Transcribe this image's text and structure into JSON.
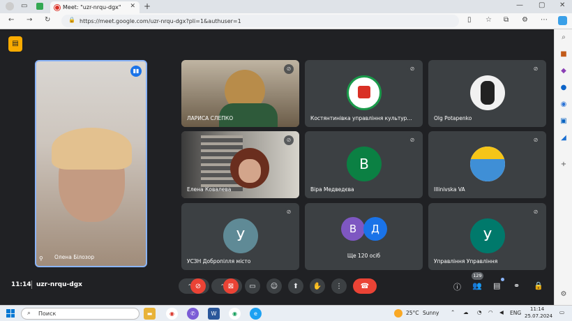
{
  "browser": {
    "tab_title": "Meet: \"uzr-nrqu-dgx\"",
    "url": "https://meet.google.com/uzr-nrqu-dgx?pli=1&authuser=1"
  },
  "meet": {
    "main_participant": {
      "name": "Олена Білозор"
    },
    "tiles": [
      {
        "name": "ЛАРИСА СЛЕПКО",
        "kind": "video"
      },
      {
        "name": "Костянтинівка управління культур...",
        "kind": "logo"
      },
      {
        "name": "Olg Potapenko",
        "kind": "photo"
      },
      {
        "name": "Елена Ковалева",
        "kind": "video"
      },
      {
        "name": "Віра Медведєва",
        "kind": "avatar",
        "letter": "В",
        "color": "#0b8043"
      },
      {
        "name": "Illinivska VA",
        "kind": "logo"
      },
      {
        "name": "УСЗН Добропілля місто",
        "kind": "avatar",
        "letter": "У",
        "color": "#5f8a96"
      },
      {
        "name": "Ще 120 осіб",
        "kind": "more",
        "letters": [
          "В",
          "Д"
        ],
        "colors": [
          "#7e57c2",
          "#1a73e8"
        ]
      },
      {
        "name": "Управління Управління",
        "kind": "avatar",
        "letter": "У",
        "color": "#00796b"
      }
    ],
    "time": "11:14",
    "meeting_code": "uzr-nrqu-dgx",
    "participants_count": "129",
    "accent": "#ea4335"
  },
  "taskbar": {
    "search_label": "Поиск",
    "temperature": "25°C",
    "weather": "Sunny",
    "lang": "ENG",
    "clock_time": "11:14",
    "clock_date": "25.07.2024"
  }
}
